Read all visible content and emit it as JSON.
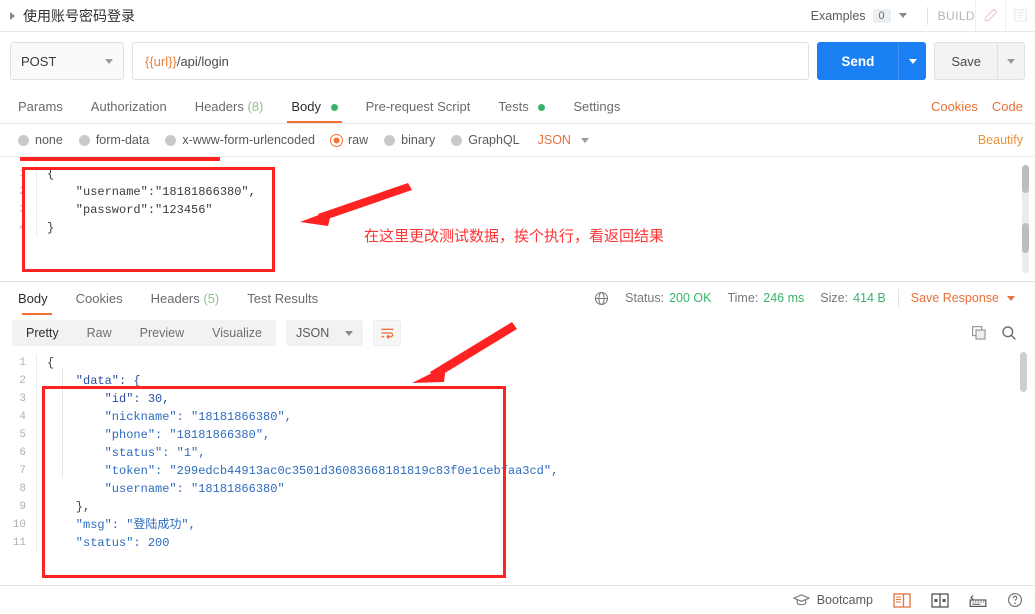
{
  "topbar": {
    "request_name": "使用账号密码登录",
    "examples_label": "Examples",
    "examples_count": "0",
    "build_label": "BUILD",
    "edit_icon": "pencil-icon",
    "docs_icon": "documentation-icon"
  },
  "url_row": {
    "method": "POST",
    "url_variable": "{{url}}",
    "url_path": "/api/login",
    "send_label": "Send",
    "save_label": "Save"
  },
  "request_tabs": [
    {
      "label": "Params",
      "active": false,
      "badge": ""
    },
    {
      "label": "Authorization",
      "active": false,
      "badge": ""
    },
    {
      "label": "Headers",
      "active": false,
      "badge": "(8)"
    },
    {
      "label": "Body",
      "active": true,
      "badge": "",
      "dot": true
    },
    {
      "label": "Pre-request Script",
      "active": false,
      "badge": ""
    },
    {
      "label": "Tests",
      "active": false,
      "badge": "",
      "dot": true
    },
    {
      "label": "Settings",
      "active": false,
      "badge": ""
    }
  ],
  "request_tabs_right": [
    {
      "label": "Cookies"
    },
    {
      "label": "Code"
    }
  ],
  "body_types": [
    {
      "label": "none",
      "selected": false
    },
    {
      "label": "form-data",
      "selected": false
    },
    {
      "label": "x-www-form-urlencoded",
      "selected": false
    },
    {
      "label": "raw",
      "selected": true
    },
    {
      "label": "binary",
      "selected": false
    },
    {
      "label": "GraphQL",
      "selected": false
    }
  ],
  "body_format": "JSON",
  "beautify_label": "Beautify",
  "request_body_lines": [
    {
      "n": "1",
      "text": "{"
    },
    {
      "n": "2",
      "text": "    \"username\":\"18181866380\","
    },
    {
      "n": "3",
      "text": "    \"password\":\"123456\""
    },
    {
      "n": "4",
      "text": "}"
    }
  ],
  "response_tabs": [
    {
      "label": "Body",
      "active": true,
      "badge": ""
    },
    {
      "label": "Cookies",
      "active": false,
      "badge": ""
    },
    {
      "label": "Headers",
      "active": false,
      "badge": "(5)"
    },
    {
      "label": "Test Results",
      "active": false,
      "badge": ""
    }
  ],
  "response_status": {
    "globe_icon": "globe-icon",
    "status_label": "Status:",
    "status_value": "200 OK",
    "time_label": "Time:",
    "time_value": "246 ms",
    "size_label": "Size:",
    "size_value": "414 B",
    "save_response_label": "Save Response"
  },
  "response_view_tabs": [
    {
      "label": "Pretty",
      "active": true
    },
    {
      "label": "Raw",
      "active": false
    },
    {
      "label": "Preview",
      "active": false
    },
    {
      "label": "Visualize",
      "active": false
    }
  ],
  "response_format": "JSON",
  "response_body_lines": [
    {
      "n": "1",
      "text": "{"
    },
    {
      "n": "2",
      "text": "    \"data\": {"
    },
    {
      "n": "3",
      "text": "        \"id\": 30,"
    },
    {
      "n": "4",
      "text": "        \"nickname\": \"18181866380\","
    },
    {
      "n": "5",
      "text": "        \"phone\": \"18181866380\","
    },
    {
      "n": "6",
      "text": "        \"status\": \"1\","
    },
    {
      "n": "7",
      "text": "        \"token\": \"299edcb44913ac0c3501d36083668181819c83f0e1cebfaa3cd\","
    },
    {
      "n": "8",
      "text": "        \"username\": \"18181866380\""
    },
    {
      "n": "9",
      "text": "    },"
    },
    {
      "n": "10",
      "text": "    \"msg\": \"登陆成功\","
    },
    {
      "n": "11",
      "text": "    \"status\": 200"
    }
  ],
  "annotations": {
    "note_text": "在这里更改测试数据，挨个执行，看返回结果",
    "color": "#ff2222"
  },
  "bottombar": {
    "bootcamp_label": "Bootcamp",
    "icons": [
      "graduation-cap-icon",
      "two-pane-layout-icon",
      "split-pane-icon",
      "console-icon",
      "help-icon"
    ]
  }
}
